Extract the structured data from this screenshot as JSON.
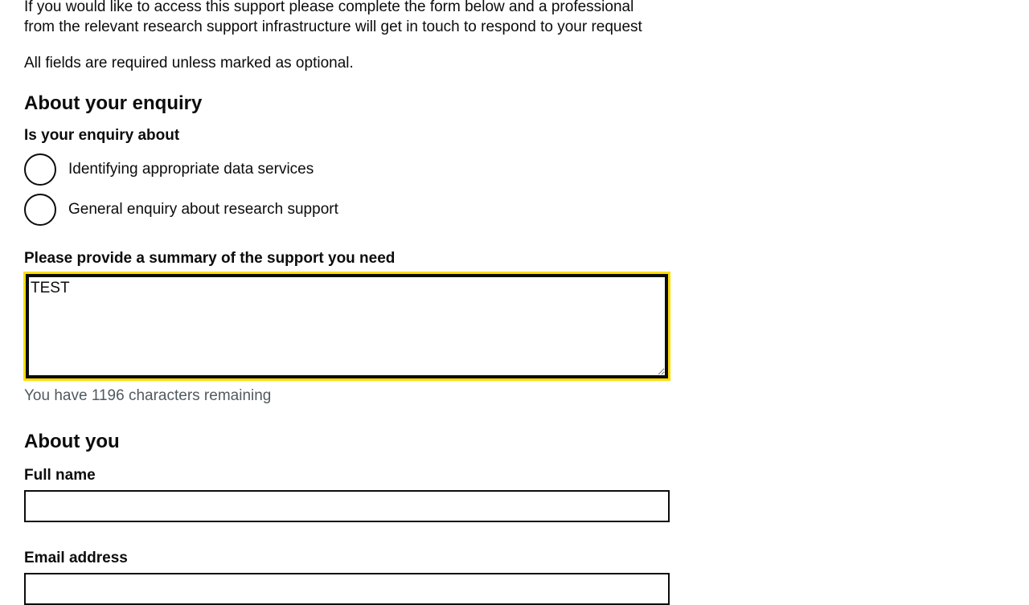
{
  "intro": {
    "line1": "If you would like to access this support please complete the form below and a professional",
    "line2": "from the relevant research support infrastructure will get in touch to respond to your request",
    "required_note": "All fields are required unless marked as optional."
  },
  "enquiry": {
    "heading": "About your enquiry",
    "question": "Is your enquiry about",
    "options": [
      {
        "label": "Identifying appropriate data services",
        "selected": false
      },
      {
        "label": "General enquiry about research support",
        "selected": false
      }
    ],
    "summary_label": "Please provide a summary of the support you need",
    "summary_value": "TEST",
    "counter": "You have 1196 characters remaining"
  },
  "about_you": {
    "heading": "About you",
    "full_name_label": "Full name",
    "full_name_value": "",
    "email_label": "Email address",
    "email_value": ""
  },
  "colors": {
    "focus": "#ffdd00",
    "text": "#0b0c0c",
    "hint": "#505a5f"
  }
}
